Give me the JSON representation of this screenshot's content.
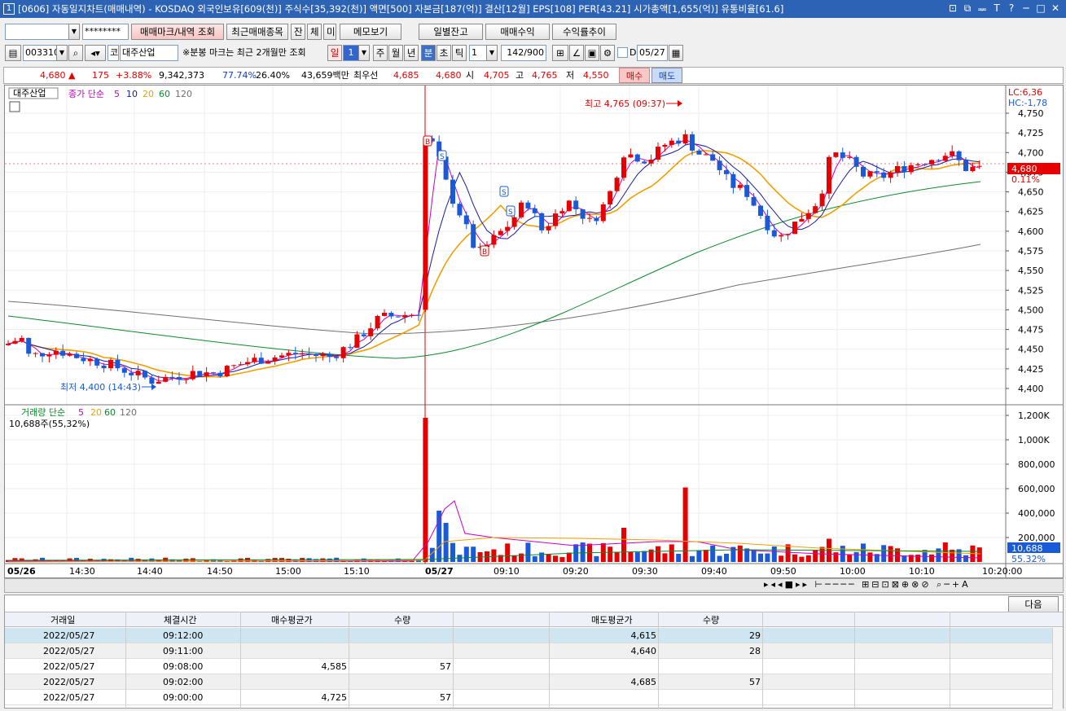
{
  "window": {
    "num": "1",
    "title": "[0606] 자동일지차트(매매내역) - KOSDAQ 외국인보유[609(천)] 주식수[35,392(천)] 액면[500] 자본금[187(억)] 결산[12월] EPS[108] PER[43.21] 시가총액[1,655(억)] 유통비율[61.6]",
    "btn_a": "⊡",
    "btn_b": "⧉",
    "btn_c": "ᆓ",
    "btn_t": "T",
    "btn_help": "?",
    "btn_min": "─",
    "btn_max": "□",
    "btn_close": "✕"
  },
  "toolbar1": {
    "account_value": "",
    "password_mask": "********",
    "btn_mark": "매매마크/내역 조회",
    "btn_recent": "최근매매종목",
    "btn_jan": "잔",
    "btn_che": "체",
    "btn_mi": "미",
    "btn_memo": "메모보기",
    "btn_daily": "일별잔고",
    "btn_profit": "매매수익",
    "btn_rate": "수익률추이"
  },
  "toolbar2": {
    "code": "003310",
    "market": "코",
    "name": "대주산업",
    "notice": "※분봉 마크는 최근 2개월만 조회",
    "period_label": "일",
    "period_value": "1",
    "ju": "주",
    "wol": "월",
    "nyeon": "년",
    "bun": "분",
    "cho": "초",
    "tick": "틱",
    "interval": "1",
    "count": "142/900",
    "d_label": "D",
    "date": "05/27"
  },
  "pricebar": {
    "price": "4,680",
    "arrow": "▲",
    "change": "175",
    "pct": "+3.88%",
    "volume": "9,342,373",
    "vol_ratio": "77.74%",
    "turnover": "26.40%",
    "amount": "43,659백만",
    "best_label": "최우선",
    "best_sell": "4,685",
    "best_buy": "4,680",
    "open_label": "시",
    "open": "4,705",
    "high_label": "고",
    "high": "4,765",
    "low_label": "저",
    "low": "4,550",
    "buy_btn": "매수",
    "sell_btn": "매도"
  },
  "chart": {
    "stock_label": "대주산업",
    "ma_label": "종가 단순",
    "ma5": "5",
    "ma10": "10",
    "ma20": "20",
    "ma60": "60",
    "ma120": "120",
    "vol_label": "거래량 단순",
    "vol_info": "10,688주(55,32%)",
    "max_label": "최고 4,765 (09:37)",
    "min_label": "최저 4,400 (14:43)",
    "lc": "LC:6,36",
    "hc": "HC:-1,78",
    "cur_price": "4,680",
    "cur_pct": "0.11%",
    "cur_vol": "10,688",
    "cur_vol_pct": "55.32%",
    "price_ticks": [
      "4,750",
      "4,725",
      "4,700",
      "4,675",
      "4,650",
      "4,625",
      "4,600",
      "4,575",
      "4,550",
      "4,525",
      "4,500",
      "4,475",
      "4,450",
      "4,425",
      "4,400"
    ],
    "vol_ticks": [
      "1,200K",
      "1,000K",
      "800,000",
      "600,000",
      "400,000",
      "200,000"
    ],
    "time_labels": [
      "05/26",
      "14:30",
      "14:40",
      "14:50",
      "15:00",
      "15:10",
      "05/27",
      "09:10",
      "09:20",
      "09:30",
      "09:40",
      "09:50",
      "10:00",
      "10:10",
      "10:20:00"
    ],
    "colors": {
      "up": "#e60000",
      "down": "#1a5ad8",
      "ma5": "#c800c8",
      "ma10": "#1a1aa0",
      "ma20": "#f0a000",
      "ma60": "#0a8a2a",
      "ma120": "#707070"
    }
  },
  "gridpanel": {
    "next_btn": "다음",
    "headers": [
      "거래일",
      "체결시간",
      "매수평균가",
      "수량",
      "",
      "매도평균가",
      "수량"
    ],
    "rows": [
      {
        "date": "2022/05/27",
        "time": "09:12:00",
        "buy_avg": "",
        "buy_qty": "",
        "sell_avg": "4,615",
        "sell_qty": "29"
      },
      {
        "date": "2022/05/27",
        "time": "09:11:00",
        "buy_avg": "",
        "buy_qty": "",
        "sell_avg": "4,640",
        "sell_qty": "28"
      },
      {
        "date": "2022/05/27",
        "time": "09:08:00",
        "buy_avg": "4,585",
        "buy_qty": "57",
        "sell_avg": "",
        "sell_qty": ""
      },
      {
        "date": "2022/05/27",
        "time": "09:02:00",
        "buy_avg": "",
        "buy_qty": "",
        "sell_avg": "4,685",
        "sell_qty": "57"
      },
      {
        "date": "2022/05/27",
        "time": "09:00:00",
        "buy_avg": "4,725",
        "buy_qty": "57",
        "sell_avg": "",
        "sell_qty": ""
      }
    ]
  },
  "chart_data": {
    "type": "candlestick",
    "x_range": [
      "05/26 14:22",
      "05/27 10:20"
    ],
    "ylim": [
      4390,
      4770
    ],
    "y2lim": [
      0,
      1250000
    ],
    "markers": {
      "high": {
        "value": 4765,
        "time": "09:37"
      },
      "low": {
        "value": 4400,
        "time": "14:43"
      }
    },
    "trades": [
      {
        "type": "B",
        "time": "09:00",
        "price": 4725
      },
      {
        "type": "S",
        "time": "09:02",
        "price": 4685
      },
      {
        "type": "B",
        "time": "09:08",
        "price": 4585
      },
      {
        "type": "S",
        "time": "09:11",
        "price": 4640
      },
      {
        "type": "S",
        "time": "09:12",
        "price": 4615
      }
    ]
  }
}
